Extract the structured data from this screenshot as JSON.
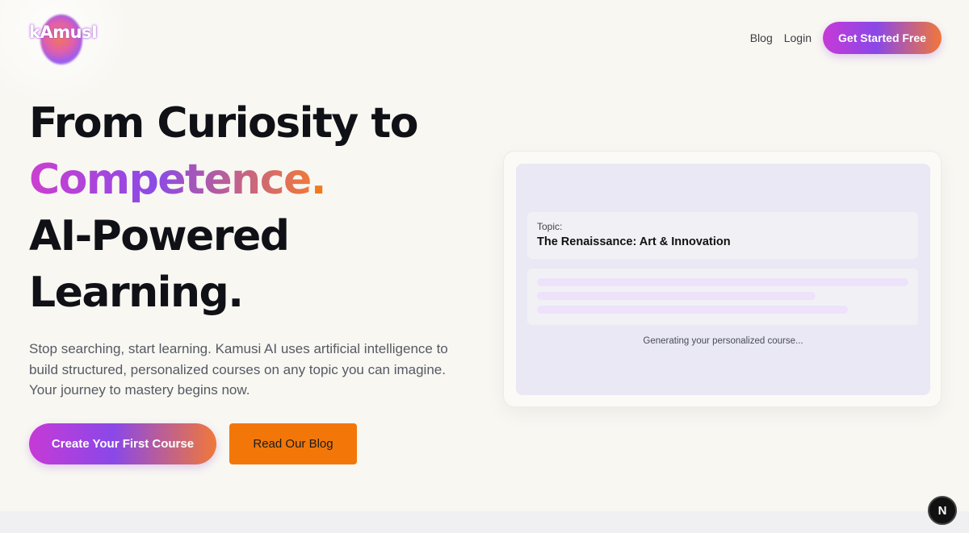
{
  "brand": {
    "logo_text": "kAmusI"
  },
  "nav": {
    "blog_label": "Blog",
    "login_label": "Login",
    "cta_label": "Get Started Free"
  },
  "hero": {
    "line1": "From Curiosity to",
    "line2": "Competence",
    "line2_dot": ".",
    "line3": "AI-Powered",
    "line4": "Learning.",
    "lead": "Stop searching, start learning. Kamusi AI uses artificial intelligence to build structured, personalized courses on any topic you can imagine. Your journey to mastery begins now.",
    "primary_cta": "Create Your First Course",
    "secondary_cta": "Read Our Blog"
  },
  "preview": {
    "topic_label": "Topic:",
    "topic_value": "The Renaissance: Art & Innovation",
    "status_text": "Generating your personalized course..."
  },
  "dev_badge": {
    "label": "N"
  },
  "colors": {
    "background": "#f8f7f2",
    "gradient_start": "#c63ad6",
    "gradient_mid": "#8a48e8",
    "gradient_end": "#f0783a",
    "orange": "#f27708"
  }
}
